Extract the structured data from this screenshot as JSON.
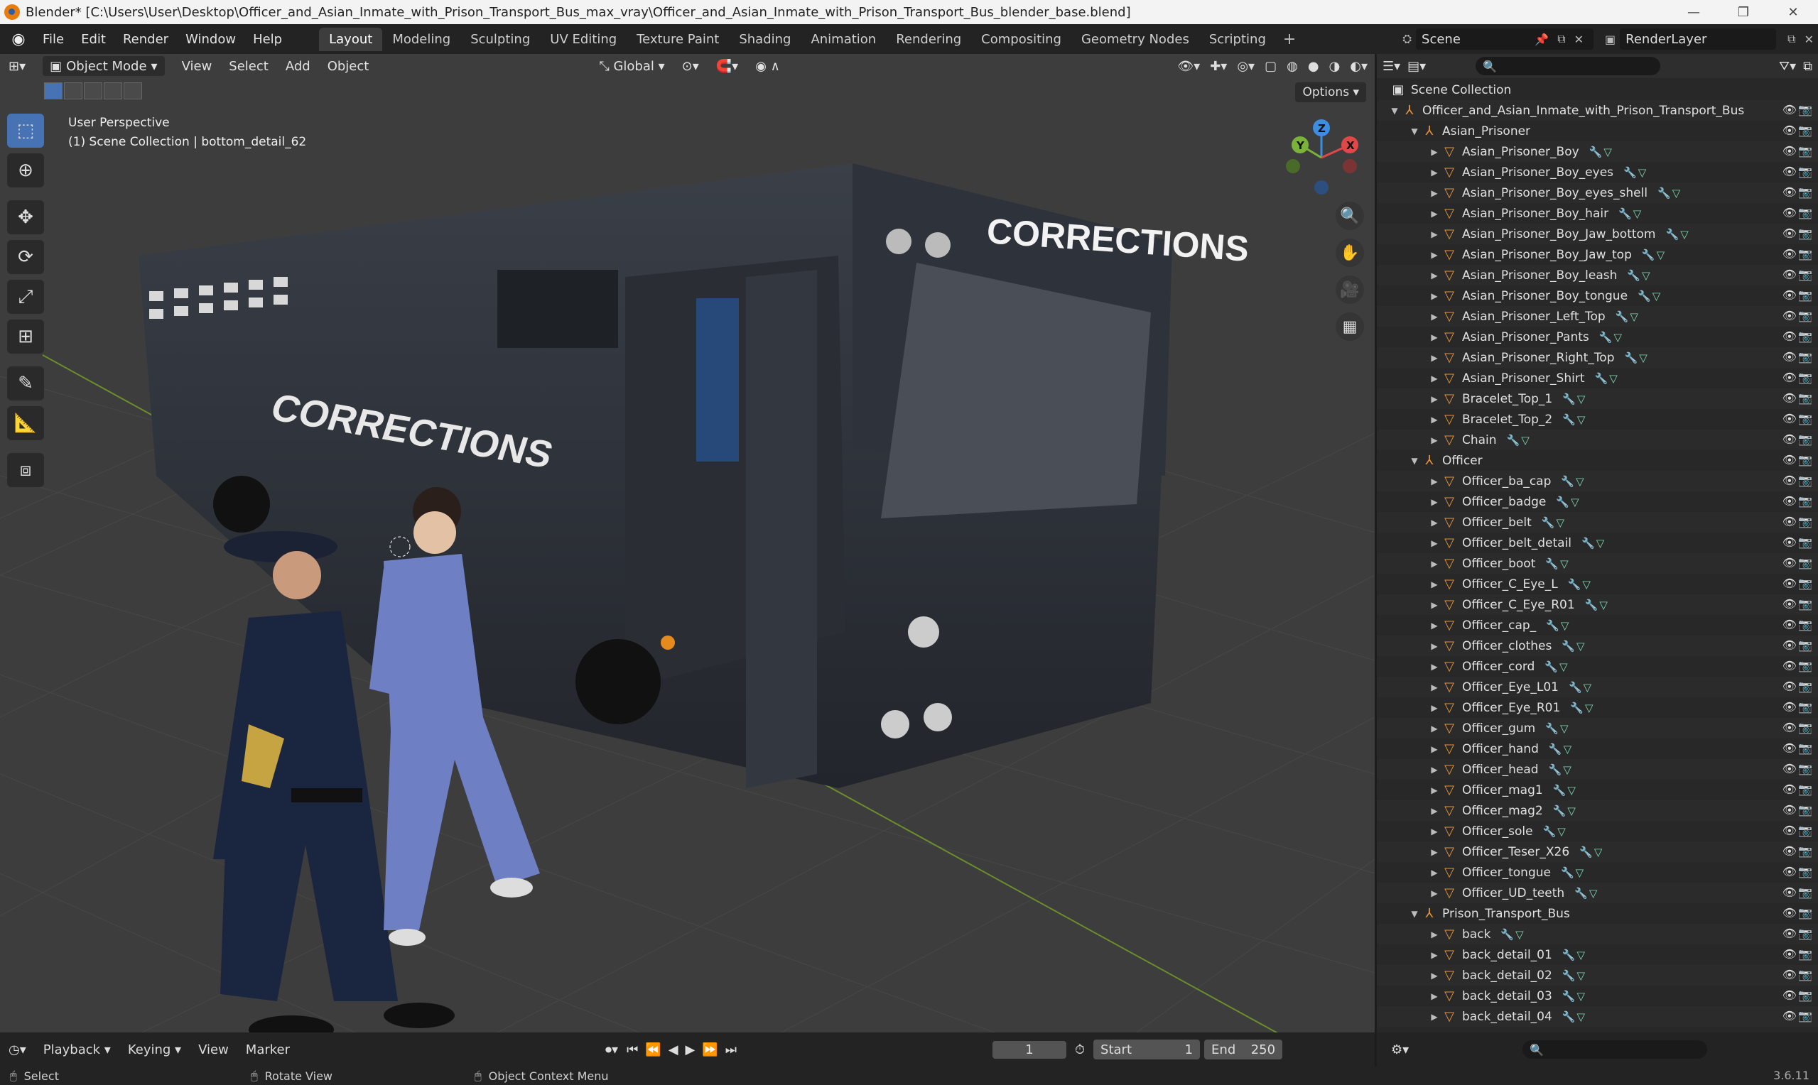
{
  "window": {
    "title": "Blender* [C:\\Users\\User\\Desktop\\Officer_and_Asian_Inmate_with_Prison_Transport_Bus_max_vray\\Officer_and_Asian_Inmate_with_Prison_Transport_Bus_blender_base.blend]",
    "minimize": "—",
    "maximize": "❐",
    "close": "✕"
  },
  "menu": [
    "File",
    "Edit",
    "Render",
    "Window",
    "Help"
  ],
  "workspaces": [
    "Layout",
    "Modeling",
    "Sculpting",
    "UV Editing",
    "Texture Paint",
    "Shading",
    "Animation",
    "Rendering",
    "Compositing",
    "Geometry Nodes",
    "Scripting"
  ],
  "active_workspace": "Layout",
  "scene": {
    "name": "Scene",
    "layer": "RenderLayer"
  },
  "viewport": {
    "mode": "Object Mode",
    "menus": [
      "View",
      "Select",
      "Add",
      "Object"
    ],
    "orientation": "Global",
    "options": "Options",
    "info_line1": "User Perspective",
    "info_line2": "(1) Scene Collection | bottom_detail_62",
    "bus_text": "CORRECTIONS",
    "gizmo_axes": [
      "Z",
      "Y",
      "X"
    ]
  },
  "outliner": {
    "root": "Scene Collection",
    "items": [
      {
        "label": "Officer_and_Asian_Inmate_with_Prison_Transport_Bus",
        "depth": 1,
        "type": "empty",
        "expanded": true
      },
      {
        "label": "Asian_Prisoner",
        "depth": 2,
        "type": "empty",
        "expanded": true
      },
      {
        "label": "Asian_Prisoner_Boy",
        "depth": 3,
        "type": "mesh"
      },
      {
        "label": "Asian_Prisoner_Boy_eyes",
        "depth": 3,
        "type": "mesh"
      },
      {
        "label": "Asian_Prisoner_Boy_eyes_shell",
        "depth": 3,
        "type": "mesh"
      },
      {
        "label": "Asian_Prisoner_Boy_hair",
        "depth": 3,
        "type": "mesh"
      },
      {
        "label": "Asian_Prisoner_Boy_Jaw_bottom",
        "depth": 3,
        "type": "mesh"
      },
      {
        "label": "Asian_Prisoner_Boy_Jaw_top",
        "depth": 3,
        "type": "mesh"
      },
      {
        "label": "Asian_Prisoner_Boy_leash",
        "depth": 3,
        "type": "mesh"
      },
      {
        "label": "Asian_Prisoner_Boy_tongue",
        "depth": 3,
        "type": "mesh"
      },
      {
        "label": "Asian_Prisoner_Left_Top",
        "depth": 3,
        "type": "mesh"
      },
      {
        "label": "Asian_Prisoner_Pants",
        "depth": 3,
        "type": "mesh"
      },
      {
        "label": "Asian_Prisoner_Right_Top",
        "depth": 3,
        "type": "mesh"
      },
      {
        "label": "Asian_Prisoner_Shirt",
        "depth": 3,
        "type": "mesh"
      },
      {
        "label": "Bracelet_Top_1",
        "depth": 3,
        "type": "mesh"
      },
      {
        "label": "Bracelet_Top_2",
        "depth": 3,
        "type": "mesh"
      },
      {
        "label": "Chain",
        "depth": 3,
        "type": "mesh"
      },
      {
        "label": "Officer",
        "depth": 2,
        "type": "empty",
        "expanded": true
      },
      {
        "label": "Officer_ba_cap",
        "depth": 3,
        "type": "mesh"
      },
      {
        "label": "Officer_badge",
        "depth": 3,
        "type": "mesh"
      },
      {
        "label": "Officer_belt",
        "depth": 3,
        "type": "mesh"
      },
      {
        "label": "Officer_belt_detail",
        "depth": 3,
        "type": "mesh"
      },
      {
        "label": "Officer_boot",
        "depth": 3,
        "type": "mesh"
      },
      {
        "label": "Officer_C_Eye_L",
        "depth": 3,
        "type": "mesh"
      },
      {
        "label": "Officer_C_Eye_R01",
        "depth": 3,
        "type": "mesh"
      },
      {
        "label": "Officer_cap_",
        "depth": 3,
        "type": "mesh"
      },
      {
        "label": "Officer_clothes",
        "depth": 3,
        "type": "mesh"
      },
      {
        "label": "Officer_cord",
        "depth": 3,
        "type": "mesh"
      },
      {
        "label": "Officer_Eye_L01",
        "depth": 3,
        "type": "mesh"
      },
      {
        "label": "Officer_Eye_R01",
        "depth": 3,
        "type": "mesh"
      },
      {
        "label": "Officer_gum",
        "depth": 3,
        "type": "mesh"
      },
      {
        "label": "Officer_hand",
        "depth": 3,
        "type": "mesh"
      },
      {
        "label": "Officer_head",
        "depth": 3,
        "type": "mesh"
      },
      {
        "label": "Officer_mag1",
        "depth": 3,
        "type": "mesh"
      },
      {
        "label": "Officer_mag2",
        "depth": 3,
        "type": "mesh"
      },
      {
        "label": "Officer_sole",
        "depth": 3,
        "type": "mesh"
      },
      {
        "label": "Officer_Teser_X26",
        "depth": 3,
        "type": "mesh"
      },
      {
        "label": "Officer_tongue",
        "depth": 3,
        "type": "mesh"
      },
      {
        "label": "Officer_UD_teeth",
        "depth": 3,
        "type": "mesh"
      },
      {
        "label": "Prison_Transport_Bus",
        "depth": 2,
        "type": "empty",
        "expanded": true
      },
      {
        "label": "back",
        "depth": 3,
        "type": "mesh"
      },
      {
        "label": "back_detail_01",
        "depth": 3,
        "type": "mesh"
      },
      {
        "label": "back_detail_02",
        "depth": 3,
        "type": "mesh"
      },
      {
        "label": "back_detail_03",
        "depth": 3,
        "type": "mesh"
      },
      {
        "label": "back_detail_04",
        "depth": 3,
        "type": "mesh"
      }
    ]
  },
  "timeline": {
    "menus": [
      "Playback",
      "Keying",
      "View",
      "Marker"
    ],
    "current_frame": "1",
    "start_label": "Start",
    "start": "1",
    "end_label": "End",
    "end": "250"
  },
  "status": {
    "select": "Select",
    "rotate": "Rotate View",
    "context": "Object Context Menu",
    "version": "3.6.11"
  },
  "colors": {
    "accent": "#4772b3",
    "object_orange": "#e8953a",
    "modifier_blue": "#7fa8e6",
    "mesh_green": "#7cd6b0",
    "axis_x": "#e04848",
    "axis_y": "#7ab23a",
    "axis_z": "#3d8ee0"
  }
}
